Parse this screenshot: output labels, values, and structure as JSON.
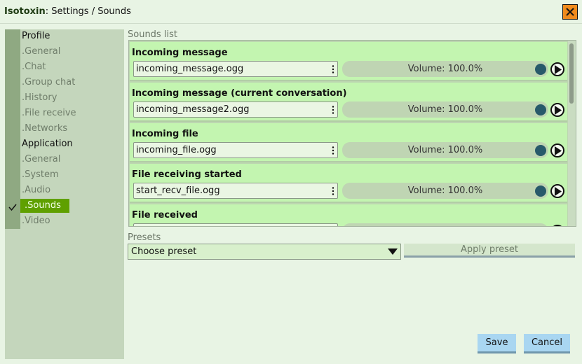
{
  "window": {
    "app_name": "Isotoxin",
    "title_rest": ": Settings / Sounds"
  },
  "sidebar": {
    "items": [
      {
        "label": "Profile",
        "kind": "header"
      },
      {
        "label": ".General",
        "kind": "sub"
      },
      {
        "label": ".Chat",
        "kind": "sub"
      },
      {
        "label": ".Group chat",
        "kind": "sub"
      },
      {
        "label": ".History",
        "kind": "sub"
      },
      {
        "label": ".File receive",
        "kind": "sub"
      },
      {
        "label": ".Networks",
        "kind": "sub"
      },
      {
        "label": "Application",
        "kind": "header"
      },
      {
        "label": ".General",
        "kind": "sub"
      },
      {
        "label": ".System",
        "kind": "sub"
      },
      {
        "label": ".Audio",
        "kind": "sub"
      },
      {
        "label": ".Sounds",
        "kind": "selected"
      },
      {
        "label": ".Video",
        "kind": "sub"
      }
    ]
  },
  "sounds": {
    "label": "Sounds list",
    "rows": [
      {
        "title": "Incoming message",
        "file": "incoming_message.ogg",
        "volume": "Volume: 100.0%"
      },
      {
        "title": "Incoming message (current conversation)",
        "file": "incoming_message2.ogg",
        "volume": "Volume: 100.0%"
      },
      {
        "title": "Incoming file",
        "file": "incoming_file.ogg",
        "volume": "Volume: 100.0%"
      },
      {
        "title": "File receiving started",
        "file": "start_recv_file.ogg",
        "volume": "Volume: 100.0%"
      },
      {
        "title": "File received",
        "file": "",
        "volume": ""
      }
    ]
  },
  "presets": {
    "label": "Presets",
    "selected": "Choose preset",
    "apply_label": "Apply preset"
  },
  "footer": {
    "save_label": "Save",
    "cancel_label": "Cancel"
  },
  "colors": {
    "accent_selected": "#5fa000",
    "row_background": "#c3f5b0",
    "button": "#a9d6f1",
    "close": "#f08a1c"
  }
}
